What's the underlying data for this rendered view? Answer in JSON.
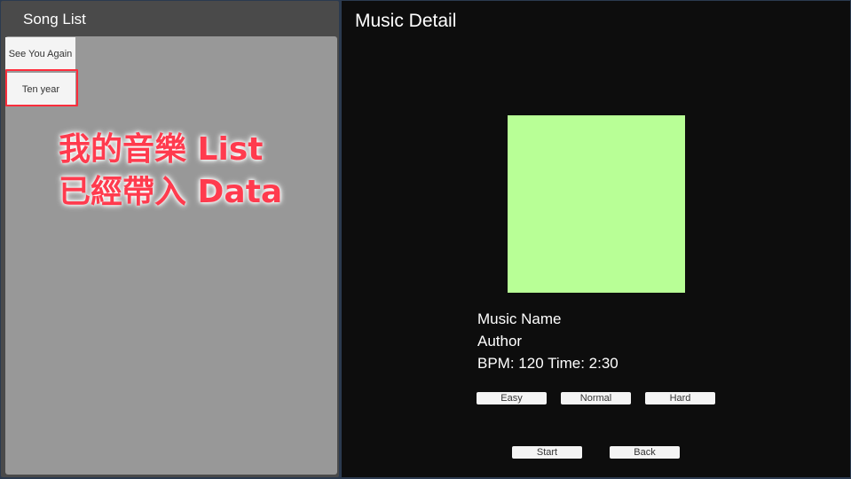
{
  "song_list": {
    "title": "Song List",
    "items": [
      {
        "label": "See You Again"
      },
      {
        "label": "Ten year"
      }
    ]
  },
  "annotation": {
    "line1": "我的音樂 List",
    "line2": "已經帶入 Data",
    "color": "#ff3b4e"
  },
  "music_detail": {
    "title": "Music Detail",
    "cover_color": "#b8ff96",
    "music_name": "Music Name",
    "author": "Author",
    "bpm_time": "BPM: 120 Time: 2:30",
    "difficulty": {
      "easy": "Easy",
      "normal": "Normal",
      "hard": "Hard"
    },
    "actions": {
      "start": "Start",
      "back": "Back"
    }
  }
}
